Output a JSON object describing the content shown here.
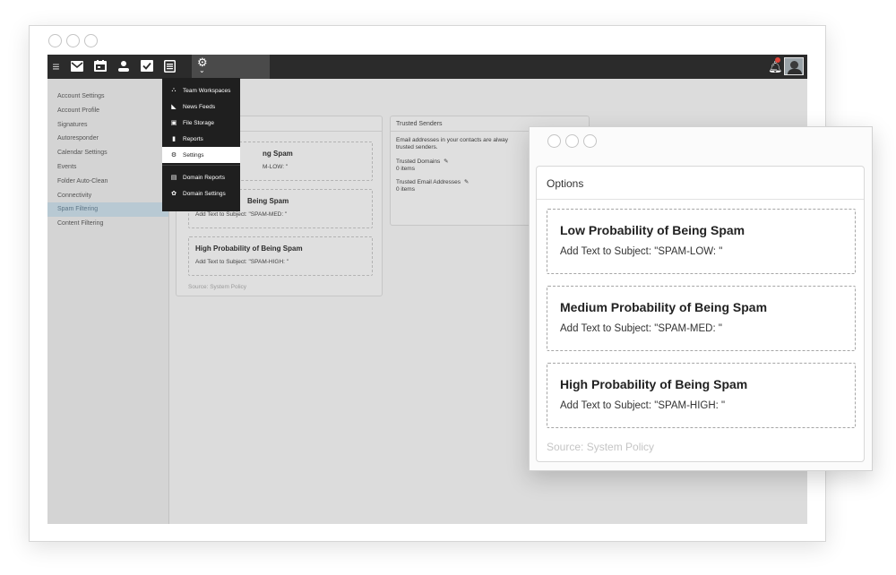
{
  "topbar": {
    "icons": [
      "menu-icon",
      "mail-icon",
      "calendar-icon",
      "contacts-icon",
      "tasks-icon",
      "notes-icon",
      "settings-gear-icon",
      "chevron-down-icon",
      "notification-bell-icon",
      "avatar"
    ]
  },
  "sidebar": {
    "items": [
      {
        "label": "Account Settings"
      },
      {
        "label": "Account Profile"
      },
      {
        "label": "Signatures"
      },
      {
        "label": "Autoresponder"
      },
      {
        "label": "Calendar Settings"
      },
      {
        "label": "Events"
      },
      {
        "label": "Folder Auto-Clean"
      },
      {
        "label": "Connectivity"
      },
      {
        "label": "Spam Filtering"
      },
      {
        "label": "Content Filtering"
      }
    ],
    "active_index": 8
  },
  "options_panel": {
    "title_visible": "O",
    "cards": [
      {
        "title_visible": "ng Spam",
        "subtitle_visible": "M-LOW: \""
      },
      {
        "title_visible": "Being Spam",
        "subtitle_visible": "Add Text to Subject: \"SPAM-MED: \""
      },
      {
        "title": "High Probability of Being Spam",
        "subtitle": "Add Text to Subject: \"SPAM-HIGH: \""
      }
    ],
    "source": "Source: System Policy"
  },
  "trusted_senders": {
    "title": "Trusted Senders",
    "description_line1": "Email addresses in your contacts are alway",
    "description_line2": "trusted senders.",
    "domains_label": "Trusted Domains",
    "domains_count": "0 items",
    "addresses_label": "Trusted Email Addresses",
    "addresses_count": "0 items"
  },
  "settings_menu": {
    "items": [
      {
        "icon": "team-workspaces-icon",
        "glyph": "⛬",
        "label": "Team Workspaces"
      },
      {
        "icon": "rss-icon",
        "glyph": "◣",
        "label": "News Feeds"
      },
      {
        "icon": "file-storage-icon",
        "glyph": "▣",
        "label": "File Storage"
      },
      {
        "icon": "bar-chart-icon",
        "glyph": "▮",
        "label": "Reports"
      },
      {
        "icon": "gear-icon",
        "glyph": "⚙",
        "label": "Settings"
      },
      {
        "icon": "domain-reports-icon",
        "glyph": "▤",
        "label": "Domain Reports"
      },
      {
        "icon": "domain-settings-icon",
        "glyph": "✿",
        "label": "Domain Settings"
      }
    ],
    "selected_index": 4
  },
  "zoom_window": {
    "panel_title": "Options",
    "cards": [
      {
        "title": "Low Probability of Being Spam",
        "subtitle": "Add Text to Subject: \"SPAM-LOW: \""
      },
      {
        "title": "Medium Probability of Being Spam",
        "subtitle": "Add Text to Subject: \"SPAM-MED: \""
      },
      {
        "title": "High Probability of Being Spam",
        "subtitle": "Add Text to Subject: \"SPAM-HIGH: \""
      }
    ],
    "source": "Source: System Policy"
  },
  "colors": {
    "topbar": "#2b2b2b",
    "sidebar_active": "#b8c9d3",
    "notification_dot": "#e0453a"
  }
}
